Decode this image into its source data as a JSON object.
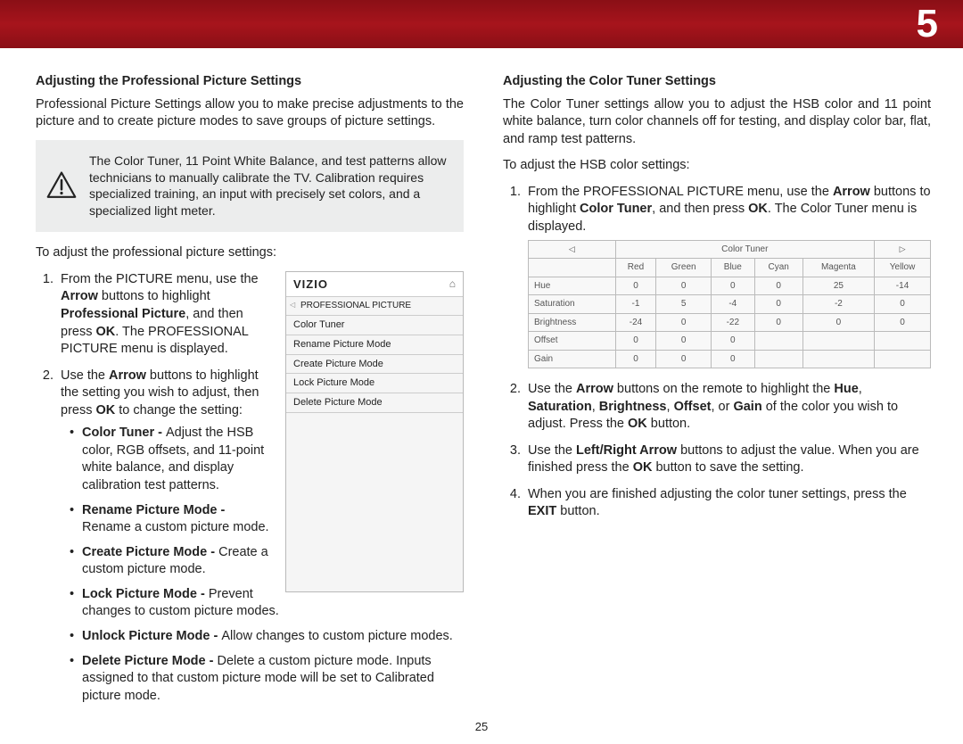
{
  "header": {
    "chapter_number": "5"
  },
  "page_number": "25",
  "left": {
    "heading": "Adjusting the Professional Picture Settings",
    "intro": "Professional Picture Settings allow you to make precise adjustments to the picture and to create picture modes to save groups of picture settings.",
    "callout": "The Color Tuner, 11 Point White Balance, and test patterns allow technicians to manually calibrate the TV. Calibration requires specialized training, an input with precisely set colors, and a specialized light meter.",
    "lead": "To adjust the professional picture settings:",
    "step1_a": "From the PICTURE menu, use the ",
    "step1_b": " buttons to highlight ",
    "step1_c": ", and then press ",
    "step1_d": ". The PROFESSIONAL PICTURE menu is displayed.",
    "step2_a": "Use the ",
    "step2_b": " buttons to highlight the setting you wish to adjust, then press ",
    "step2_c": " to change the setting:",
    "bullets": {
      "b1_t": "Color Tuner - ",
      "b1_d": "Adjust the HSB color, RGB offsets, and 11-point white balance, and display calibration test patterns.",
      "b2_t": "Rename Picture Mode - ",
      "b2_d": "Rename a custom picture mode.",
      "b3_t": "Create Picture Mode - ",
      "b3_d": "Create a custom picture mode.",
      "b4_t": "Lock Picture Mode - ",
      "b4_d": "Prevent changes to custom picture modes.",
      "b5_t": "Unlock Picture Mode - ",
      "b5_d": "Allow changes to custom picture modes.",
      "b6_t": "Delete Picture Mode - ",
      "b6_d": "Delete a custom picture mode. Inputs assigned to that custom picture mode will be set to Calibrated picture mode."
    },
    "menu": {
      "brand": "VIZIO",
      "crumb": "PROFESSIONAL PICTURE",
      "items": [
        "Color Tuner",
        "Rename Picture Mode",
        "Create Picture Mode",
        "Lock Picture Mode",
        "Delete Picture Mode"
      ]
    },
    "kw": {
      "arrow": "Arrow",
      "profpic": "Professional Picture",
      "ok": "OK"
    }
  },
  "right": {
    "heading": "Adjusting the Color Tuner Settings",
    "intro": "The Color Tuner settings allow you to adjust the HSB color and 11 point white balance, turn color channels off for testing, and display color bar, flat, and ramp test patterns.",
    "lead": "To adjust the HSB color settings:",
    "step1_a": "From the PROFESSIONAL PICTURE menu, use the ",
    "step1_b": " buttons to highlight ",
    "step1_c": ", and then press ",
    "step1_d": ". The Color Tuner menu is displayed.",
    "step2_a": "Use the ",
    "step2_b": " buttons on the remote to highlight the ",
    "step2_c": " of the color you wish to adjust. Press the ",
    "step2_d": "  button.",
    "step3_a": "Use the ",
    "step3_b": " buttons to adjust the value. When you are finished press the ",
    "step3_c": " button to save the setting.",
    "step4_a": "When you are finished adjusting the color tuner settings, press the ",
    "step4_b": " button.",
    "kw": {
      "arrow": "Arrow",
      "colortuner": "Color Tuner",
      "ok": "OK",
      "hue": "Hue",
      "sat": "Saturation",
      "bri": "Brightness",
      "off": "Offset",
      "gain": "Gain",
      "lrarrow": "Left/Right Arrow",
      "exit": "EXIT"
    }
  },
  "chart_data": {
    "type": "table",
    "title": "Color Tuner",
    "columns": [
      "Red",
      "Green",
      "Blue",
      "Cyan",
      "Magenta",
      "Yellow"
    ],
    "rows": [
      {
        "label": "Hue",
        "values": [
          "0",
          "0",
          "0",
          "0",
          "25",
          "-14"
        ]
      },
      {
        "label": "Saturation",
        "values": [
          "-1",
          "5",
          "-4",
          "0",
          "-2",
          "0"
        ]
      },
      {
        "label": "Brightness",
        "values": [
          "-24",
          "0",
          "-22",
          "0",
          "0",
          "0"
        ]
      },
      {
        "label": "Offset",
        "values": [
          "0",
          "0",
          "0",
          "",
          "",
          ""
        ]
      },
      {
        "label": "Gain",
        "values": [
          "0",
          "0",
          "0",
          "",
          "",
          ""
        ]
      }
    ]
  }
}
